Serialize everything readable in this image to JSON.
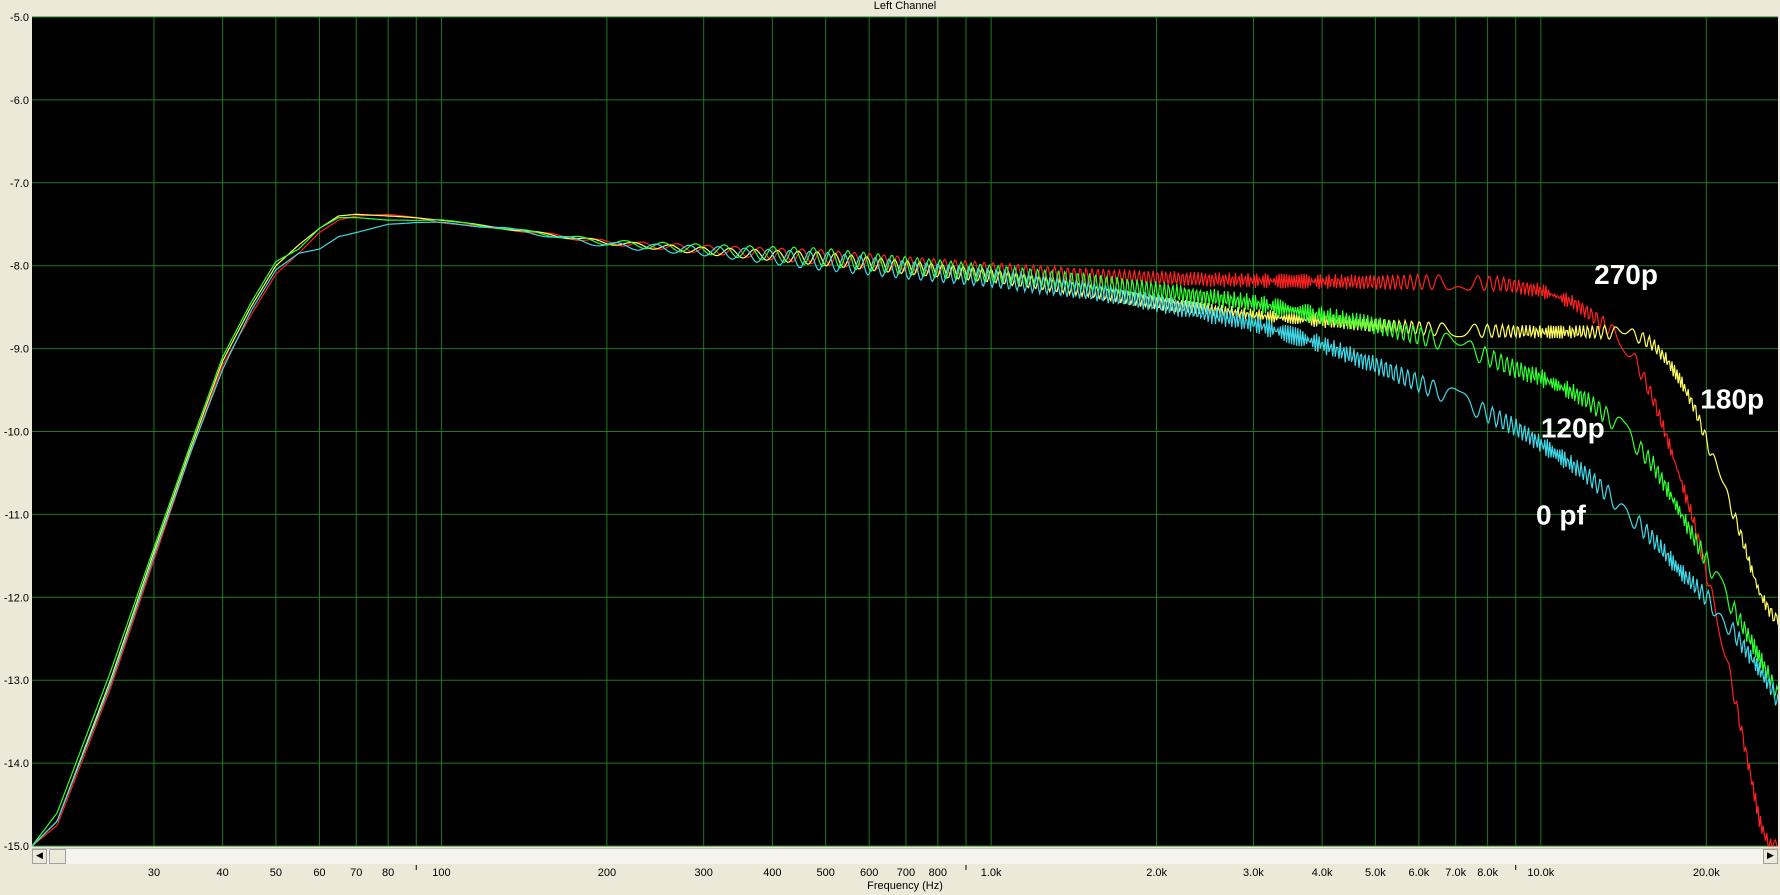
{
  "window": {
    "title": "Left Channel"
  },
  "scrollbar": {
    "left_arrow": "◀",
    "right_arrow": "▶"
  },
  "colors": {
    "background": "#000000",
    "grid": "#1f7a1f",
    "frame": "#ece9d8",
    "red": "#ff2020",
    "yellow": "#ffff60",
    "green": "#30ff30",
    "cyan": "#40d8e8"
  },
  "chart_data": {
    "type": "line",
    "title": "Left Channel",
    "xlabel": "Frequency (Hz)",
    "ylabel": "",
    "xscale": "log",
    "xlim": [
      18,
      27000
    ],
    "ylim": [
      -15.0,
      -5.0
    ],
    "grid": true,
    "y_ticks": [
      {
        "value": -5,
        "label": "-5.0"
      },
      {
        "value": -6,
        "label": "-6.0"
      },
      {
        "value": -7,
        "label": "-7.0"
      },
      {
        "value": -8,
        "label": "-8.0"
      },
      {
        "value": -9,
        "label": "-9.0"
      },
      {
        "value": -10,
        "label": "-10.0"
      },
      {
        "value": -11,
        "label": "-11.0"
      },
      {
        "value": -12,
        "label": "-12.0"
      },
      {
        "value": -13,
        "label": "-13.0"
      },
      {
        "value": -14,
        "label": "-14.0"
      },
      {
        "value": -15,
        "label": "-15.0"
      }
    ],
    "x_ticks": [
      {
        "value": 30,
        "label": "30"
      },
      {
        "value": 40,
        "label": "40"
      },
      {
        "value": 50,
        "label": "50"
      },
      {
        "value": 60,
        "label": "60"
      },
      {
        "value": 70,
        "label": "70"
      },
      {
        "value": 80,
        "label": "80"
      },
      {
        "value": 90,
        "label": ""
      },
      {
        "value": 100,
        "label": "100"
      },
      {
        "value": 200,
        "label": "200"
      },
      {
        "value": 300,
        "label": "300"
      },
      {
        "value": 400,
        "label": "400"
      },
      {
        "value": 500,
        "label": "500"
      },
      {
        "value": 600,
        "label": "600"
      },
      {
        "value": 700,
        "label": "700"
      },
      {
        "value": 800,
        "label": "800"
      },
      {
        "value": 900,
        "label": ""
      },
      {
        "value": 1000,
        "label": "1.0k"
      },
      {
        "value": 2000,
        "label": "2.0k"
      },
      {
        "value": 3000,
        "label": "3.0k"
      },
      {
        "value": 4000,
        "label": "4.0k"
      },
      {
        "value": 5000,
        "label": "5.0k"
      },
      {
        "value": 6000,
        "label": "6.0k"
      },
      {
        "value": 7000,
        "label": "7.0k"
      },
      {
        "value": 8000,
        "label": "8.0k"
      },
      {
        "value": 9000,
        "label": ""
      },
      {
        "value": 10000,
        "label": "10.0k"
      },
      {
        "value": 20000,
        "label": "20.0k"
      }
    ],
    "series": [
      {
        "name": "270p",
        "color": "#ff2020",
        "ripple": 0.09,
        "x": [
          18,
          20,
          25,
          30,
          35,
          40,
          45,
          50,
          55,
          60,
          65,
          70,
          80,
          90,
          100,
          130,
          200,
          300,
          500,
          700,
          1000,
          1500,
          2000,
          3000,
          5000,
          7000,
          8500,
          10000,
          11500,
          13000,
          14000,
          15000,
          16000,
          17000,
          18000,
          19000,
          20000,
          21000,
          22000,
          23000,
          24000,
          25000,
          26000,
          27000
        ],
        "y": [
          -15.0,
          -14.75,
          -13.1,
          -11.55,
          -10.25,
          -9.2,
          -8.6,
          -8.1,
          -7.85,
          -7.6,
          -7.45,
          -7.4,
          -7.38,
          -7.42,
          -7.48,
          -7.55,
          -7.72,
          -7.8,
          -7.9,
          -7.98,
          -8.05,
          -8.12,
          -8.15,
          -8.18,
          -8.2,
          -8.2,
          -8.22,
          -8.3,
          -8.45,
          -8.7,
          -8.9,
          -9.2,
          -9.6,
          -10.1,
          -10.6,
          -11.1,
          -11.7,
          -12.3,
          -12.9,
          -13.5,
          -14.1,
          -14.7,
          -15.0,
          -15.0
        ]
      },
      {
        "name": "180p",
        "color": "#ffff60",
        "ripple": 0.08,
        "x": [
          18,
          20,
          25,
          30,
          35,
          40,
          45,
          50,
          55,
          60,
          65,
          70,
          80,
          90,
          100,
          130,
          200,
          300,
          500,
          700,
          1000,
          1500,
          2000,
          3000,
          5000,
          7000,
          10000,
          13000,
          15000,
          16000,
          17000,
          18000,
          19000,
          20000,
          21000,
          22000,
          23000,
          24000,
          25000,
          26000,
          27000
        ],
        "y": [
          -15.0,
          -14.7,
          -13.0,
          -11.45,
          -10.2,
          -9.15,
          -8.5,
          -8.0,
          -7.75,
          -7.55,
          -7.4,
          -7.38,
          -7.4,
          -7.42,
          -7.45,
          -7.55,
          -7.72,
          -7.82,
          -7.92,
          -8.02,
          -8.12,
          -8.3,
          -8.45,
          -8.6,
          -8.72,
          -8.78,
          -8.8,
          -8.8,
          -8.85,
          -8.95,
          -9.15,
          -9.4,
          -9.7,
          -10.1,
          -10.5,
          -10.85,
          -11.2,
          -11.6,
          -11.95,
          -12.15,
          -12.3
        ]
      },
      {
        "name": "120p",
        "color": "#30ff30",
        "ripple": 0.11,
        "x": [
          18,
          20,
          25,
          30,
          35,
          40,
          45,
          50,
          55,
          60,
          65,
          70,
          80,
          90,
          100,
          130,
          200,
          300,
          500,
          700,
          1000,
          1500,
          2000,
          3000,
          5000,
          7000,
          8000,
          9000,
          10000,
          12000,
          14000,
          16000,
          17000,
          18000,
          20000,
          22000,
          24000,
          26000,
          27000
        ],
        "y": [
          -15.0,
          -14.6,
          -12.9,
          -11.4,
          -10.15,
          -9.1,
          -8.45,
          -7.95,
          -7.8,
          -7.55,
          -7.42,
          -7.42,
          -7.45,
          -7.45,
          -7.45,
          -7.55,
          -7.72,
          -7.8,
          -7.9,
          -8.0,
          -8.1,
          -8.2,
          -8.3,
          -8.45,
          -8.72,
          -8.95,
          -9.1,
          -9.25,
          -9.35,
          -9.6,
          -9.95,
          -10.4,
          -10.7,
          -11.0,
          -11.55,
          -12.05,
          -12.5,
          -12.95,
          -13.2
        ]
      },
      {
        "name": "0 pf",
        "color": "#40d8e8",
        "ripple": 0.11,
        "x": [
          18,
          20,
          25,
          30,
          35,
          40,
          45,
          50,
          55,
          60,
          65,
          70,
          80,
          90,
          100,
          130,
          200,
          300,
          500,
          700,
          1000,
          1500,
          2000,
          3000,
          4000,
          5000,
          7000,
          9000,
          10000,
          12000,
          14000,
          16000,
          18000,
          20000,
          22000,
          24000,
          26000,
          27000
        ],
        "y": [
          -15.0,
          -14.7,
          -13.05,
          -11.5,
          -10.25,
          -9.25,
          -8.55,
          -8.05,
          -7.85,
          -7.8,
          -7.65,
          -7.6,
          -7.5,
          -7.48,
          -7.48,
          -7.55,
          -7.75,
          -7.82,
          -7.95,
          -8.05,
          -8.15,
          -8.3,
          -8.45,
          -8.7,
          -8.95,
          -9.2,
          -9.6,
          -9.95,
          -10.15,
          -10.5,
          -10.9,
          -11.3,
          -11.7,
          -12.0,
          -12.35,
          -12.7,
          -13.05,
          -13.25
        ]
      }
    ],
    "annotations": [
      {
        "text": "270p",
        "x": 12500,
        "y": -8.1,
        "color": "#ffffff"
      },
      {
        "text": "180p",
        "x": 19500,
        "y": -9.6,
        "color": "#ffffff"
      },
      {
        "text": "120p",
        "x": 10000,
        "y": -9.95,
        "color": "#ffffff"
      },
      {
        "text": "0 pf",
        "x": 9800,
        "y": -11.0,
        "color": "#ffffff"
      }
    ]
  }
}
